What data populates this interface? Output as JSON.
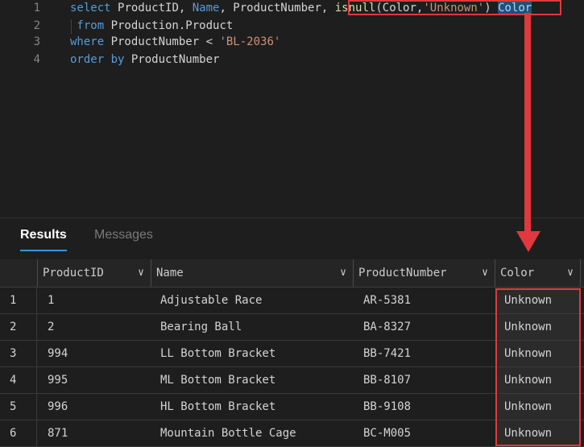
{
  "editor": {
    "lines": [
      {
        "num": "1",
        "tokens": [
          {
            "t": "select ",
            "c": "kw"
          },
          {
            "t": "ProductID, ",
            "c": "plain"
          },
          {
            "t": "Name",
            "c": "kw"
          },
          {
            "t": ", ProductNumber, ",
            "c": "plain"
          },
          {
            "t": "isnull",
            "c": "plain"
          },
          {
            "t": "(",
            "c": "plain"
          },
          {
            "t": "Color",
            "c": "plain"
          },
          {
            "t": ",",
            "c": "plain"
          },
          {
            "t": "'Unknown'",
            "c": "str"
          },
          {
            "t": ") ",
            "c": "plain"
          },
          {
            "t": "Color",
            "c": "sel"
          }
        ]
      },
      {
        "num": "2",
        "tokens": [
          {
            "t": " from ",
            "c": "kw"
          },
          {
            "t": "Production.Product",
            "c": "plain"
          }
        ]
      },
      {
        "num": "3",
        "tokens": [
          {
            "t": "where ",
            "c": "kw"
          },
          {
            "t": "ProductNumber < ",
            "c": "plain"
          },
          {
            "t": "'BL-2036'",
            "c": "str"
          }
        ]
      },
      {
        "num": "4",
        "tokens": [
          {
            "t": "order by ",
            "c": "kw"
          },
          {
            "t": "ProductNumber",
            "c": "plain"
          }
        ]
      }
    ]
  },
  "results": {
    "tabs": {
      "results": "Results",
      "messages": "Messages"
    },
    "columns": [
      "ProductID",
      "Name",
      "ProductNumber",
      "Color"
    ],
    "rows": [
      {
        "n": "1",
        "ProductID": "1",
        "Name": "Adjustable Race",
        "ProductNumber": "AR-5381",
        "Color": "Unknown"
      },
      {
        "n": "2",
        "ProductID": "2",
        "Name": "Bearing Ball",
        "ProductNumber": "BA-8327",
        "Color": "Unknown"
      },
      {
        "n": "3",
        "ProductID": "994",
        "Name": "LL Bottom Bracket",
        "ProductNumber": "BB-7421",
        "Color": "Unknown"
      },
      {
        "n": "4",
        "ProductID": "995",
        "Name": "ML Bottom Bracket",
        "ProductNumber": "BB-8107",
        "Color": "Unknown"
      },
      {
        "n": "5",
        "ProductID": "996",
        "Name": "HL Bottom Bracket",
        "ProductNumber": "BB-9108",
        "Color": "Unknown"
      },
      {
        "n": "6",
        "ProductID": "871",
        "Name": "Mountain Bottle Cage",
        "ProductNumber": "BC-M005",
        "Color": "Unknown"
      }
    ]
  },
  "annotation": {
    "color": "#e0383e"
  }
}
